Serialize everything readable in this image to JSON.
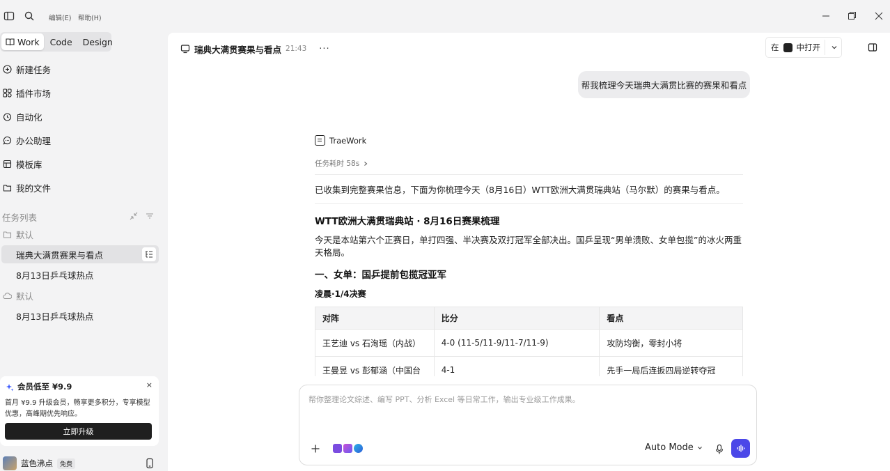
{
  "titlebar": {
    "menus": [
      "编辑(E)",
      "帮助(H)"
    ]
  },
  "sidebar": {
    "mode_tabs": [
      {
        "label": "Work",
        "active": true
      },
      {
        "label": "Code",
        "active": false
      },
      {
        "label": "Design",
        "active": false
      }
    ],
    "nav_items": [
      {
        "label": "新建任务",
        "icon": "new-task-icon"
      },
      {
        "label": "插件市场",
        "icon": "plugin-market-icon"
      },
      {
        "label": "自动化",
        "icon": "clock-icon"
      },
      {
        "label": "办公助理",
        "icon": "chat-icon"
      },
      {
        "label": "模板库",
        "icon": "template-icon"
      },
      {
        "label": "我的文件",
        "icon": "folder-icon"
      }
    ],
    "task_list_title": "任务列表",
    "groups": [
      {
        "label": "默认",
        "icon": "folder-icon",
        "tasks": [
          "瑞典大满贯赛果与看点",
          "8月13日乒乓球热点"
        ]
      },
      {
        "label": "默认",
        "icon": "cloud-icon",
        "tasks": [
          "8月13日乒乓球热点"
        ]
      }
    ],
    "active_task": "瑞典大满贯赛果与看点",
    "promo": {
      "title": "会员低至 ¥9.9",
      "description": "首月 ¥9.9 升级会员，畅享更多积分，专享模型优惠，高峰期优先响应。",
      "button": "立即升级",
      "close": "×"
    },
    "user": {
      "name": "蓝色沸点",
      "plan": "免费"
    }
  },
  "main": {
    "header": {
      "title": "瑞典大满贯赛果与看点",
      "time": "21:43",
      "more": "···"
    },
    "open_in": {
      "prefix": "在",
      "label": "中打开"
    },
    "user_message": "帮我梳理今天瑞典大满贯比赛的赛果和看点",
    "agent": {
      "name": "TraeWork",
      "duration": "任务耗时 58s",
      "summary": "已收集到完整赛果信息，下面为你梳理今天（8月16日）WTT欧洲大满贯瑞典站（马尔默）的赛果与看点。",
      "heading": "WTT欧洲大满贯瑞典站 · 8月16日赛果梳理",
      "intro": "今天是本站第六个正赛日，单打四强、半决赛及双打冠军全部决出。国乒呈现“男单溃败、女单包揽”的冰火两重天格局。",
      "section1": "一、女单：国乒提前包揽冠亚军",
      "subsection": "凌晨·1/4决赛",
      "table": {
        "headers": [
          "对阵",
          "比分",
          "看点"
        ],
        "rows": [
          [
            "王艺迪 vs 石洵瑶（内战）",
            "4-0 (11-5/11-9/11-7/11-9)",
            "攻防均衡，零封小将"
          ],
          [
            "王曼昱 vs 彭郁涵（中国台",
            "4-1",
            "先手一局后连扳四局逆转夺冠"
          ]
        ]
      }
    },
    "composer": {
      "placeholder": "帮你整理论文综述、编写 PPT、分析 Excel 等日常工作，输出专业级工作成果。",
      "mode": "Auto Mode"
    }
  },
  "colors": {
    "accent": "#4b47e8",
    "sidebar_bg": "#f3f3f4",
    "main_bg": "#ffffff"
  }
}
